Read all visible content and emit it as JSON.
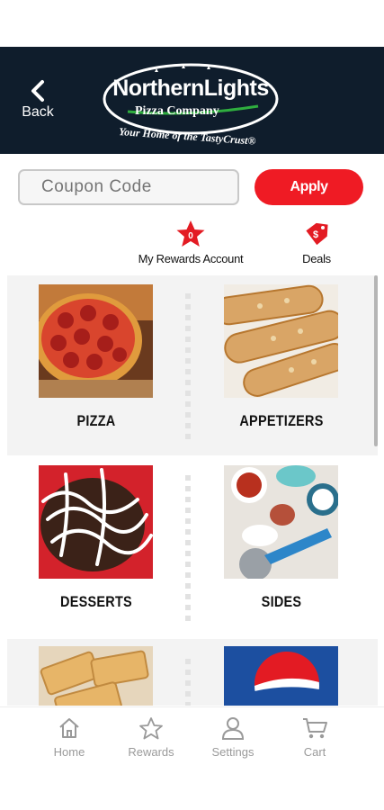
{
  "header": {
    "back_label": "Back",
    "logo_line1": "NorthernLights",
    "logo_line2": "Pizza Company",
    "logo_tagline": "Your Home of the TastyCrust®"
  },
  "coupon": {
    "placeholder": "Coupon Code",
    "apply_label": "Apply"
  },
  "quick_links": {
    "rewards_label": "My Rewards Account",
    "rewards_badge": "0",
    "deals_label": "Deals",
    "deals_badge": "$"
  },
  "categories": [
    {
      "label": "PIZZA",
      "icon": "pizza-photo"
    },
    {
      "label": "APPETIZERS",
      "icon": "breadsticks-photo"
    },
    {
      "label": "DESSERTS",
      "icon": "dessert-photo"
    },
    {
      "label": "SIDES",
      "icon": "sides-photo"
    },
    {
      "label": "",
      "icon": "cheesy-bread-photo"
    },
    {
      "label": "",
      "icon": "pepsi-photo"
    }
  ],
  "nav": {
    "home": "Home",
    "rewards": "Rewards",
    "settings": "Settings",
    "cart": "Cart"
  },
  "colors": {
    "header_bg": "#0f1d2c",
    "accent_red": "#ef1b24",
    "nav_gray": "#9a9a9a"
  }
}
